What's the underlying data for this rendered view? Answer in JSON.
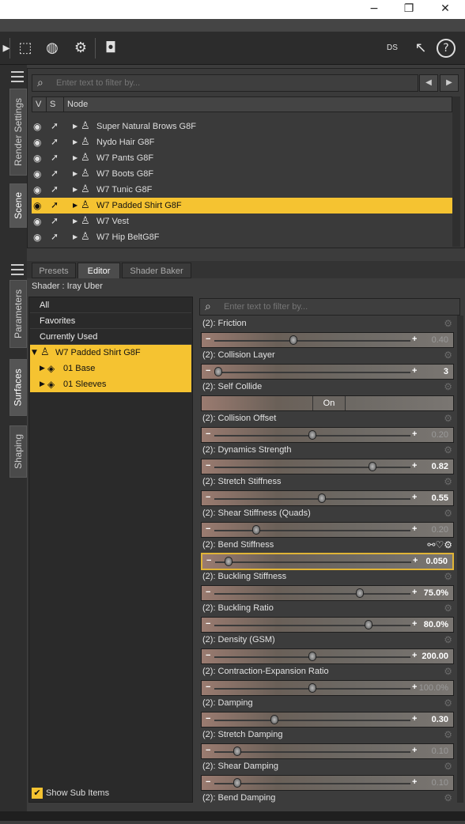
{
  "window": {
    "minimize": "−",
    "restore": "❐",
    "close": "✕"
  },
  "toolbar": {
    "help_label": "?",
    "ds_label": "DS"
  },
  "left_tabs": [
    "Render Settings",
    "Scene",
    "Parameters",
    "Surfaces",
    "Shaping"
  ],
  "scene": {
    "filter_placeholder": "Enter text to filter by...",
    "columns": [
      "V",
      "S",
      "Node"
    ],
    "nodes": [
      {
        "label": "Super Natural Brows G8F"
      },
      {
        "label": "Nydo Hair G8F"
      },
      {
        "label": "W7 Pants G8F"
      },
      {
        "label": "W7 Boots G8F"
      },
      {
        "label": "W7 Tunic G8F"
      },
      {
        "label": "W7 Padded Shirt G8F",
        "selected": true
      },
      {
        "label": "W7 Vest"
      },
      {
        "label": "W7 Hip BeltG8F"
      }
    ]
  },
  "surfaces": {
    "tabs": [
      "Presets",
      "Editor",
      "Shader Baker"
    ],
    "active_tab": "Editor",
    "shader_label": "Shader : Iray Uber",
    "tree": [
      "All",
      "Favorites",
      "Currently Used",
      "W7 Padded Shirt G8F",
      "01 Base",
      "01 Sleeves"
    ],
    "show_sub_items": "Show Sub Items",
    "filter_placeholder": "Enter text to filter by...",
    "accent_color": "#f5c331",
    "properties": [
      {
        "label": "(2): Friction",
        "value": "0.40",
        "fraction": 0.4,
        "dim": true
      },
      {
        "label": "(2): Collision Layer",
        "value": "3",
        "fraction": 0.0,
        "dim": false
      },
      {
        "label": "(2): Self Collide",
        "toggle": "On"
      },
      {
        "label": "(2): Collision Offset",
        "value": "0.20",
        "fraction": 0.5,
        "dim": true
      },
      {
        "label": "(2): Dynamics Strength",
        "value": "0.82",
        "fraction": 0.82,
        "dim": false
      },
      {
        "label": "(2): Stretch Stiffness",
        "value": "0.55",
        "fraction": 0.55,
        "dim": false
      },
      {
        "label": "(2): Shear Stiffness (Quads)",
        "value": "0.20",
        "fraction": 0.2,
        "dim": true
      },
      {
        "label": "(2): Bend Stiffness",
        "value": "0.050",
        "fraction": 0.05,
        "dim": false,
        "highlight": true
      },
      {
        "label": "(2): Buckling Stiffness",
        "value": "75.0%",
        "fraction": 0.75,
        "dim": false
      },
      {
        "label": "(2): Buckling Ratio",
        "value": "80.0%",
        "fraction": 0.8,
        "dim": false
      },
      {
        "label": "(2): Density (GSM)",
        "value": "200.00",
        "fraction": 0.5,
        "dim": false
      },
      {
        "label": "(2): Contraction-Expansion Ratio",
        "value": "100.0%",
        "fraction": 0.5,
        "dim": true
      },
      {
        "label": "(2): Damping",
        "value": "0.30",
        "fraction": 0.3,
        "dim": false
      },
      {
        "label": "(2): Stretch Damping",
        "value": "0.10",
        "fraction": 0.1,
        "dim": true
      },
      {
        "label": "(2): Shear Damping",
        "value": "0.10",
        "fraction": 0.1,
        "dim": true
      },
      {
        "label": "(2): Bend Damping"
      }
    ]
  }
}
